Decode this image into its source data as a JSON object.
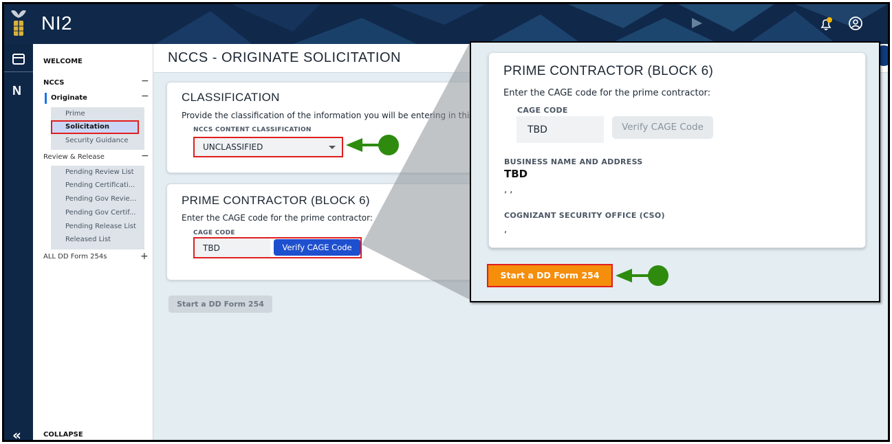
{
  "app": {
    "title": "NI2"
  },
  "topbar": {
    "icons": [
      "seal-logo-icon",
      "bell-icon",
      "account-icon"
    ],
    "notification_dot_color": "#f5b800"
  },
  "rail": {
    "icons": [
      "dashboard-icon",
      "n-app-icon",
      "collapse-chevrons-icon"
    ],
    "app_letter": "N",
    "collapse_glyph": "«"
  },
  "sidebar": {
    "welcome": "WELCOME",
    "nccs": "NCCS",
    "originate": "Originate",
    "originate_items": [
      "Prime",
      "Solicitation",
      "Security Guidance"
    ],
    "active_item": "Solicitation",
    "review_release": "Review & Release",
    "review_items": [
      "Pending Review List",
      "Pending Certificati...",
      "Pending Gov Revie...",
      "Pending Gov Certif...",
      "Pending Release List",
      "Released List"
    ],
    "all_forms": "ALL DD Form 254s",
    "collapse": "COLLAPSE",
    "minus": "−",
    "plus": "+"
  },
  "page": {
    "title": "NCCS - ORIGINATE SOLICITATION"
  },
  "classification": {
    "title": "CLASSIFICATION",
    "description": "Provide the classification of the information you will be entering in this",
    "field_label": "NCCS CONTENT CLASSIFICATION",
    "selected_value": "UNCLASSIFIED"
  },
  "prime_contractor": {
    "title": "PRIME CONTRACTOR (BLOCK 6)",
    "description": "Enter the CAGE code for the prime contractor:",
    "cage_label": "CAGE CODE",
    "cage_value": "TBD",
    "verify_button": "Verify CAGE Code"
  },
  "start_button": "Start a DD Form 254",
  "zoom": {
    "title": "PRIME CONTRACTOR (BLOCK 6)",
    "description": "Enter the CAGE code for the prime contractor:",
    "cage_label": "CAGE CODE",
    "cage_value": "TBD",
    "verify_button": "Verify CAGE Code",
    "business_label": "BUSINESS NAME AND ADDRESS",
    "business_name": "TBD",
    "business_address": ", ,",
    "cso_label": "COGNIZANT SECURITY OFFICE (CSO)",
    "cso_value": ",",
    "start_button": "Start a DD Form 254"
  },
  "colors": {
    "navy": "#0f2747",
    "highlight_red": "#e01e1e",
    "verify_blue": "#1e4fcf",
    "start_orange": "#f58e0b",
    "annotation_green": "#2e8b0e"
  }
}
